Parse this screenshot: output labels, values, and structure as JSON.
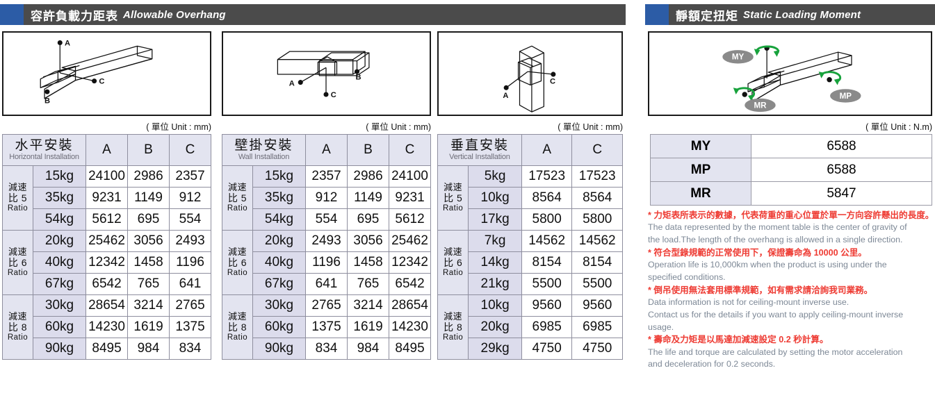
{
  "headers": {
    "left": {
      "cn": "容許負載力距表",
      "en": "Allowable Overhang"
    },
    "right": {
      "cn": "靜額定扭矩",
      "en": "Static Loading Moment"
    }
  },
  "units": {
    "mm": "( 單位 Unit : mm)",
    "nm": "( 單位 Unit : N.m)"
  },
  "figures": {
    "horizontal": {
      "labels": [
        "A",
        "B",
        "C"
      ]
    },
    "wall": {
      "labels": [
        "A",
        "B",
        "C"
      ]
    },
    "vertical": {
      "labels": [
        "A",
        "C"
      ]
    },
    "moment": {
      "labels": [
        "MY",
        "MP",
        "MR"
      ]
    }
  },
  "colors": {
    "accent_blue": "#2c5ca6",
    "header_gray": "#4b4b4b",
    "header_fill": "#e3e4f0",
    "kg_fill": "#dcdcec",
    "note_red": "#ee3b33",
    "note_gray": "#7d8896",
    "arrow_green": "#1a9e3c",
    "badge_gray": "#8a8a8a"
  },
  "tables": [
    {
      "id": "horizontal",
      "title_cn": "水平安裝",
      "title_en": "Horizontal Installation",
      "axes": [
        "A",
        "B",
        "C"
      ],
      "groups": [
        {
          "ratio_cn": "減速",
          "ratio_mid": "比 5",
          "ratio_en": "Ratio",
          "rows": [
            {
              "load": "15kg",
              "values": [
                "24100",
                "2986",
                "2357"
              ]
            },
            {
              "load": "35kg",
              "values": [
                "9231",
                "1149",
                "912"
              ]
            },
            {
              "load": "54kg",
              "values": [
                "5612",
                "695",
                "554"
              ]
            }
          ]
        },
        {
          "ratio_cn": "減速",
          "ratio_mid": "比 6",
          "ratio_en": "Ratio",
          "rows": [
            {
              "load": "20kg",
              "values": [
                "25462",
                "3056",
                "2493"
              ]
            },
            {
              "load": "40kg",
              "values": [
                "12342",
                "1458",
                "1196"
              ]
            },
            {
              "load": "67kg",
              "values": [
                "6542",
                "765",
                "641"
              ]
            }
          ]
        },
        {
          "ratio_cn": "減速",
          "ratio_mid": "比 8",
          "ratio_en": "Ratio",
          "rows": [
            {
              "load": "30kg",
              "values": [
                "28654",
                "3214",
                "2765"
              ]
            },
            {
              "load": "60kg",
              "values": [
                "14230",
                "1619",
                "1375"
              ]
            },
            {
              "load": "90kg",
              "values": [
                "8495",
                "984",
                "834"
              ]
            }
          ]
        }
      ]
    },
    {
      "id": "wall",
      "title_cn": "壁掛安裝",
      "title_en": "Wall Installation",
      "axes": [
        "A",
        "B",
        "C"
      ],
      "groups": [
        {
          "ratio_cn": "減速",
          "ratio_mid": "比 5",
          "ratio_en": "Ratio",
          "rows": [
            {
              "load": "15kg",
              "values": [
                "2357",
                "2986",
                "24100"
              ]
            },
            {
              "load": "35kg",
              "values": [
                "912",
                "1149",
                "9231"
              ]
            },
            {
              "load": "54kg",
              "values": [
                "554",
                "695",
                "5612"
              ]
            }
          ]
        },
        {
          "ratio_cn": "減速",
          "ratio_mid": "比 6",
          "ratio_en": "Ratio",
          "rows": [
            {
              "load": "20kg",
              "values": [
                "2493",
                "3056",
                "25462"
              ]
            },
            {
              "load": "40kg",
              "values": [
                "1196",
                "1458",
                "12342"
              ]
            },
            {
              "load": "67kg",
              "values": [
                "641",
                "765",
                "6542"
              ]
            }
          ]
        },
        {
          "ratio_cn": "減速",
          "ratio_mid": "比 8",
          "ratio_en": "Ratio",
          "rows": [
            {
              "load": "30kg",
              "values": [
                "2765",
                "3214",
                "28654"
              ]
            },
            {
              "load": "60kg",
              "values": [
                "1375",
                "1619",
                "14230"
              ]
            },
            {
              "load": "90kg",
              "values": [
                "834",
                "984",
                "8495"
              ]
            }
          ]
        }
      ]
    },
    {
      "id": "vertical",
      "title_cn": "垂直安裝",
      "title_en": "Vertical Installation",
      "axes": [
        "A",
        "C"
      ],
      "groups": [
        {
          "ratio_cn": "減速",
          "ratio_mid": "比 5",
          "ratio_en": "Ratio",
          "rows": [
            {
              "load": "5kg",
              "values": [
                "17523",
                "17523"
              ]
            },
            {
              "load": "10kg",
              "values": [
                "8564",
                "8564"
              ]
            },
            {
              "load": "17kg",
              "values": [
                "5800",
                "5800"
              ]
            }
          ]
        },
        {
          "ratio_cn": "減速",
          "ratio_mid": "比 6",
          "ratio_en": "Ratio",
          "rows": [
            {
              "load": "7kg",
              "values": [
                "14562",
                "14562"
              ]
            },
            {
              "load": "14kg",
              "values": [
                "8154",
                "8154"
              ]
            },
            {
              "load": "21kg",
              "values": [
                "5500",
                "5500"
              ]
            }
          ]
        },
        {
          "ratio_cn": "減速",
          "ratio_mid": "比 8",
          "ratio_en": "Ratio",
          "rows": [
            {
              "load": "10kg",
              "values": [
                "9560",
                "9560"
              ]
            },
            {
              "load": "20kg",
              "values": [
                "6985",
                "6985"
              ]
            },
            {
              "load": "29kg",
              "values": [
                "4750",
                "4750"
              ]
            }
          ]
        }
      ]
    }
  ],
  "moment_table": {
    "rows": [
      {
        "key": "MY",
        "value": "6588"
      },
      {
        "key": "MP",
        "value": "6588"
      },
      {
        "key": "MR",
        "value": "5847"
      }
    ]
  },
  "notes": [
    {
      "cn": "* 力矩表所表示的數據，代表荷重的重心位置於單一方向容許懸出的長度。",
      "en": [
        "The data represented by the moment table is the center of gravity of",
        "the load.The length of the overhang is allowed in a single direction."
      ]
    },
    {
      "cn": "* 符合型錄規範的正常使用下，保證壽命為 10000 公里。",
      "en": [
        "Operation life is 10,000km when the product is using under the",
        "specified conditions."
      ]
    },
    {
      "cn": "* 倒吊使用無法套用標準規範，如有需求請洽詢我司業務。",
      "en": [
        "Data information is not for ceiling-mount inverse use.",
        "Contact us for the details if you want to apply ceiling-mount inverse",
        "usage."
      ]
    },
    {
      "cn": "* 壽命及力矩是以馬達加減速設定 0.2 秒計算。",
      "en": [
        "The life and torque are calculated by setting the motor acceleration",
        "and deceleration for 0.2 seconds."
      ]
    }
  ]
}
